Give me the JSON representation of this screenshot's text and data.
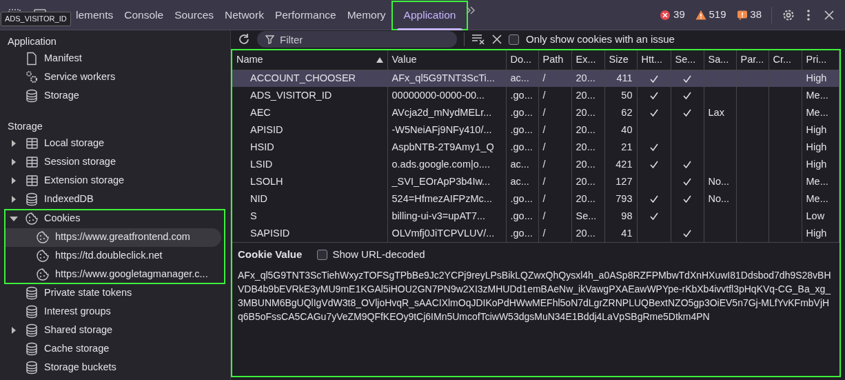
{
  "tooltip": "ADS_VISITOR_ID",
  "tabs": [
    {
      "label": "lements",
      "selected": false
    },
    {
      "label": "Console",
      "selected": false
    },
    {
      "label": "Sources",
      "selected": false
    },
    {
      "label": "Network",
      "selected": false
    },
    {
      "label": "Performance",
      "selected": false
    },
    {
      "label": "Memory",
      "selected": false
    },
    {
      "label": "Application",
      "selected": true
    }
  ],
  "counters": [
    {
      "kind": "error",
      "count": "39"
    },
    {
      "kind": "warning",
      "count": "519"
    },
    {
      "kind": "issue",
      "count": "38"
    }
  ],
  "sidebar": {
    "sections": [
      {
        "title": "Application",
        "items": [
          {
            "label": "Manifest",
            "kind": "file",
            "expandable": false
          },
          {
            "label": "Service workers",
            "kind": "gears",
            "expandable": false
          },
          {
            "label": "Storage",
            "kind": "database",
            "expandable": false
          }
        ]
      },
      {
        "title": "Storage",
        "items": [
          {
            "label": "Local storage",
            "kind": "table",
            "expandable": true,
            "expanded": false
          },
          {
            "label": "Session storage",
            "kind": "table",
            "expandable": true,
            "expanded": false
          },
          {
            "label": "Extension storage",
            "kind": "table",
            "expandable": true,
            "expanded": false
          },
          {
            "label": "IndexedDB",
            "kind": "database",
            "expandable": true,
            "expanded": false
          },
          {
            "label": "Cookies",
            "kind": "cookie",
            "expandable": true,
            "expanded": true,
            "highlighted": true,
            "children": [
              {
                "label": "https://www.greatfrontend.com",
                "kind": "cookie",
                "selected": true
              },
              {
                "label": "https://td.doubleclick.net",
                "kind": "cookie",
                "selected": false
              },
              {
                "label": "https://www.googletagmanager.c...",
                "kind": "cookie",
                "selected": false
              }
            ]
          },
          {
            "label": "Private state tokens",
            "kind": "database",
            "expandable": false
          },
          {
            "label": "Interest groups",
            "kind": "database",
            "expandable": false
          },
          {
            "label": "Shared storage",
            "kind": "database",
            "expandable": true,
            "expanded": false
          },
          {
            "label": "Cache storage",
            "kind": "database",
            "expandable": false
          },
          {
            "label": "Storage buckets",
            "kind": "database",
            "expandable": false
          }
        ]
      }
    ]
  },
  "toolbar": {
    "filter": {
      "placeholder": "Filter"
    },
    "issue_only": {
      "label": "Only show cookies with an issue",
      "checked": false
    }
  },
  "table": {
    "columns": [
      "Name",
      "Value",
      "Do...",
      "Path",
      "Ex...",
      "Size",
      "Htt...",
      "Se...",
      "Sa...",
      "Par...",
      "Cr...",
      "Pri..."
    ],
    "rows": [
      {
        "name": "ACCOUNT_CHOOSER",
        "value": "AFx_ql5G9TNT3ScTi...",
        "domain": "ac...",
        "path": "/",
        "expires": "20...",
        "size": "411",
        "http_only": true,
        "secure": true,
        "same_site": "",
        "priority": "High",
        "selected": true
      },
      {
        "name": "ADS_VISITOR_ID",
        "value": "00000000-0000-00...",
        "domain": ".go...",
        "path": "/",
        "expires": "20...",
        "size": "50",
        "http_only": true,
        "secure": true,
        "same_site": "",
        "priority": "Me...",
        "selected": false
      },
      {
        "name": "AEC",
        "value": "AVcja2d_mNydMELr...",
        "domain": ".go...",
        "path": "/",
        "expires": "20...",
        "size": "62",
        "http_only": true,
        "secure": true,
        "same_site": "Lax",
        "priority": "Me...",
        "selected": false
      },
      {
        "name": "APISID",
        "value": "-W5NeiAFj9NFy410/...",
        "domain": ".go...",
        "path": "/",
        "expires": "20...",
        "size": "40",
        "http_only": false,
        "secure": false,
        "same_site": "",
        "priority": "High",
        "selected": false
      },
      {
        "name": "HSID",
        "value": "AspbNTB-2T9Amy1_Q",
        "domain": ".go...",
        "path": "/",
        "expires": "20...",
        "size": "21",
        "http_only": true,
        "secure": false,
        "same_site": "",
        "priority": "High",
        "selected": false
      },
      {
        "name": "LSID",
        "value": "o.ads.google.com|o....",
        "domain": "ac...",
        "path": "/",
        "expires": "20...",
        "size": "421",
        "http_only": true,
        "secure": true,
        "same_site": "",
        "priority": "High",
        "selected": false
      },
      {
        "name": "LSOLH",
        "value": "_SVI_EOrApP3b4Iw...",
        "domain": "ac...",
        "path": "/",
        "expires": "20...",
        "size": "127",
        "http_only": false,
        "secure": true,
        "same_site": "No...",
        "priority": "Me...",
        "selected": false
      },
      {
        "name": "NID",
        "value": "524=HfmezAIFPzMc...",
        "domain": ".go...",
        "path": "/",
        "expires": "20...",
        "size": "793",
        "http_only": true,
        "secure": true,
        "same_site": "No...",
        "priority": "Me...",
        "selected": false
      },
      {
        "name": "S",
        "value": "billing-ui-v3=upAT7...",
        "domain": ".go...",
        "path": "/",
        "expires": "Se...",
        "size": "98",
        "http_only": true,
        "secure": false,
        "same_site": "",
        "priority": "Low",
        "selected": false
      },
      {
        "name": "SAPISID",
        "value": "OLVmfj0JiTCPVLUV/...",
        "domain": ".go...",
        "path": "/",
        "expires": "20...",
        "size": "41",
        "http_only": false,
        "secure": true,
        "same_site": "",
        "priority": "High",
        "selected": false
      }
    ]
  },
  "cookie_value": {
    "title": "Cookie Value",
    "decode": {
      "label": "Show URL-decoded",
      "checked": false
    },
    "text": "AFx_ql5G9TNT3ScTiehWxyzTOFSgTPbBe9Jc2YCPj9reyLPsBikLQZwxQhQysxl4h_a0ASp8RZFPMbwTdXnHXuwI81Ddsbod7dh9S28vBHVDB4b9bEVRkE3yMU9mE1KGAl5iHOU2GN7PN9w2XI3zMHUDd1emBAeNw_ikVawgPXAEawWPYpe-rKbXb4ivvtfl3pHqKVq-CG_Ba_xg_3MBUNM6BgUQlIgVdW3t8_OVljoHvqR_sAACIXlmOqJDIKoPdHWwMEFhl5oN7dLgrZRNPLUQBextNZO5gp3OiEV5n7Gj-MLfYvKFmbVjHq6B5oFssCA5CAGu7yVeZM9QFfKEOy9tCj6IMn5UmcofTciwW53dgsMuN34E1Bddj4LaVpSBgRme5Dtkm4PN"
  }
}
